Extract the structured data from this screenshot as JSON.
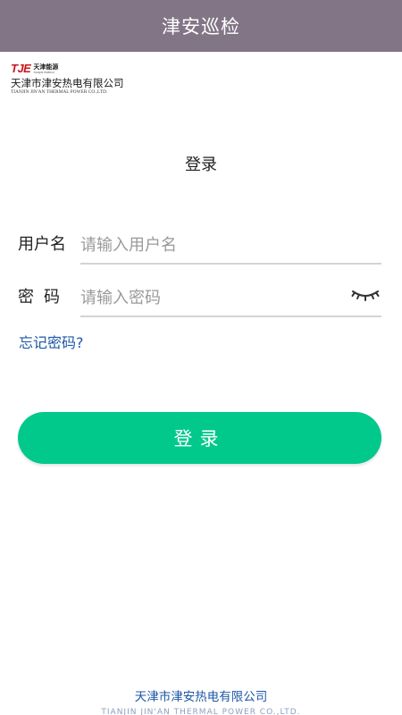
{
  "header": {
    "title": "津安巡检"
  },
  "logo": {
    "mark": "TJE",
    "mark_cn": "天津能源",
    "mark_en": "TIANJIN ENERGY",
    "company_cn": "天津市津安热电有限公司",
    "company_en": "TIANJIN JIN'AN THERMAL POWER CO.,LTD."
  },
  "form": {
    "heading": "登录",
    "username_label": "用户名",
    "username_placeholder": "请输入用户名",
    "username_value": "",
    "password_label": "密码",
    "password_placeholder": "请输入密码",
    "password_value": "",
    "password_toggle_icon": "eye-closed-icon",
    "forgot_label": "忘记密码?",
    "submit_label": "登录"
  },
  "footer": {
    "company_cn": "天津市津安热电有限公司",
    "company_en": "TIANJIN JIN'AN THERMAL POWER CO.,LTD."
  },
  "colors": {
    "titlebar": "#827585",
    "primary_button": "#00c98b",
    "link": "#1e58a8"
  }
}
